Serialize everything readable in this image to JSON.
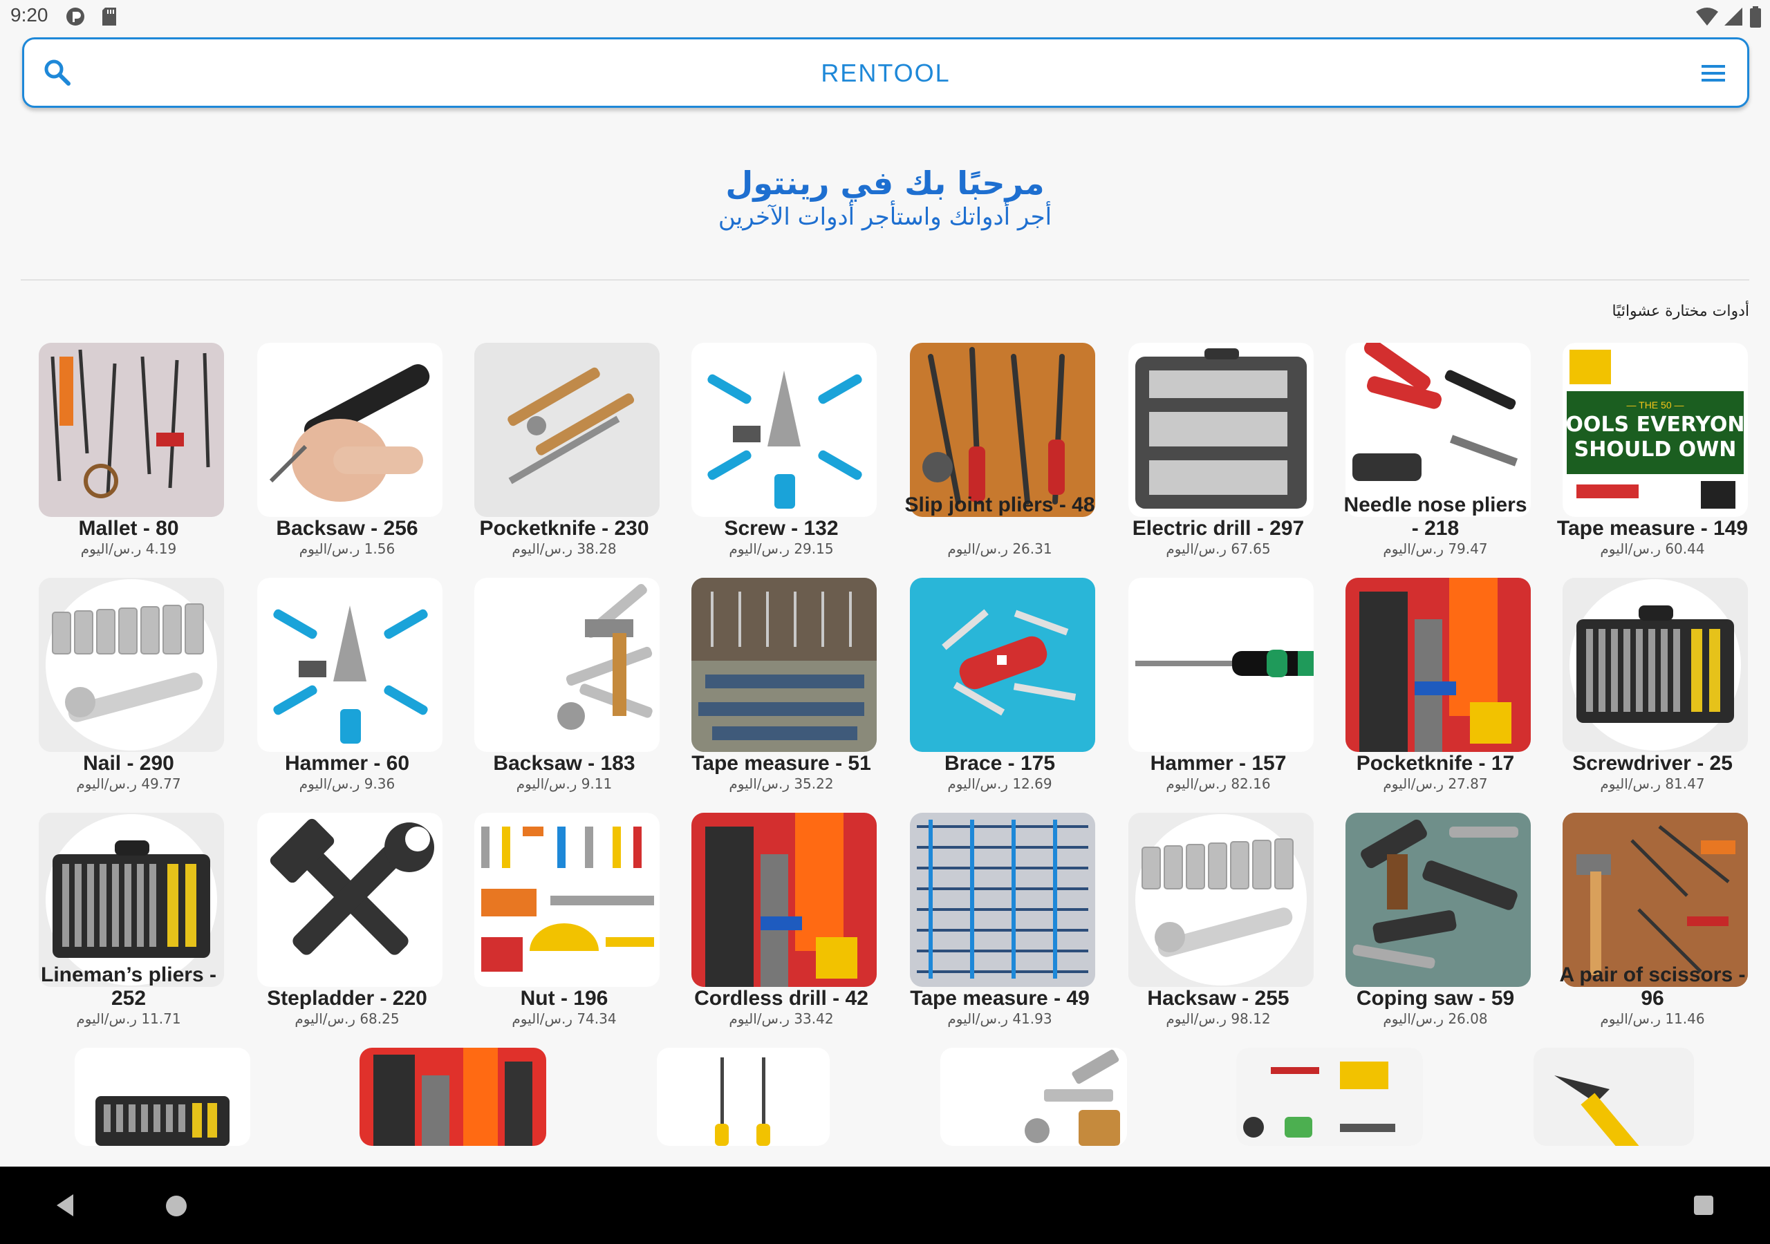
{
  "status_bar": {
    "time": "9:20"
  },
  "app_bar": {
    "title": "RENTOOL"
  },
  "welcome": {
    "title": "مرحبًا بك في رينتول",
    "subtitle": "أجر أدواتك واستأجر أدوات الآخرين"
  },
  "section_label": "أدوات مختارة عشوائيًا",
  "price_unit": "ر.س/اليوم",
  "tools": [
    {
      "name": "Mallet - 80",
      "price": "4.19",
      "image": "wall-of-tools-photo"
    },
    {
      "name": "Backsaw - 256",
      "price": "1.56",
      "image": "soldering-pen-photo"
    },
    {
      "name": "Pocketknife - 230",
      "price": "38.28",
      "image": "wooden-chisels-photo"
    },
    {
      "name": "Screw - 132",
      "price": "29.15",
      "image": "blue-tool-set-photo"
    },
    {
      "name": "Slip joint pliers - 48",
      "price": "26.31",
      "image": "pliers-on-wood-photo"
    },
    {
      "name": "Electric drill - 297",
      "price": "67.65",
      "image": "socket-case-photo"
    },
    {
      "name": "Needle nose pliers - 218",
      "price": "79.47",
      "image": "red-pliers-photo"
    },
    {
      "name": "Tape measure - 149",
      "price": "60.44",
      "image": "tools-book-cover"
    },
    {
      "name": "Nail - 290",
      "price": "49.77",
      "image": "sockets-ratchet-photo"
    },
    {
      "name": "Hammer - 60",
      "price": "9.36",
      "image": "blue-tool-set-photo"
    },
    {
      "name": "Backsaw - 183",
      "price": "9.11",
      "image": "wrenches-hammer-photo"
    },
    {
      "name": "Tape measure - 51",
      "price": "35.22",
      "image": "tool-wall-photo"
    },
    {
      "name": "Brace - 175",
      "price": "12.69",
      "image": "swiss-army-knife-photo"
    },
    {
      "name": "Hammer - 157",
      "price": "82.16",
      "image": "screwdriver-photo"
    },
    {
      "name": "Pocketknife - 17",
      "price": "27.87",
      "image": "tool-bag-photo"
    },
    {
      "name": "Screwdriver - 25",
      "price": "81.47",
      "image": "tool-case-photo"
    },
    {
      "name": "Lineman’s pliers - 252",
      "price": "11.71",
      "image": "tool-case-photo"
    },
    {
      "name": "Stepladder - 220",
      "price": "68.25",
      "image": "hammer-wrench-icon"
    },
    {
      "name": "Nut - 196",
      "price": "74.34",
      "image": "tool-illustration"
    },
    {
      "name": "Cordless drill - 42",
      "price": "33.42",
      "image": "tool-bag-photo"
    },
    {
      "name": "Tape measure - 49",
      "price": "41.93",
      "image": "tools-layout-photo"
    },
    {
      "name": "Hacksaw - 255",
      "price": "98.12",
      "image": "sockets-ratchet-photo"
    },
    {
      "name": "Coping saw - 59",
      "price": "26.08",
      "image": "wrenches-pile-photo"
    },
    {
      "name": "A pair of scissors - 96",
      "price": "11.46",
      "image": "hand-tools-on-wood-photo"
    }
  ]
}
